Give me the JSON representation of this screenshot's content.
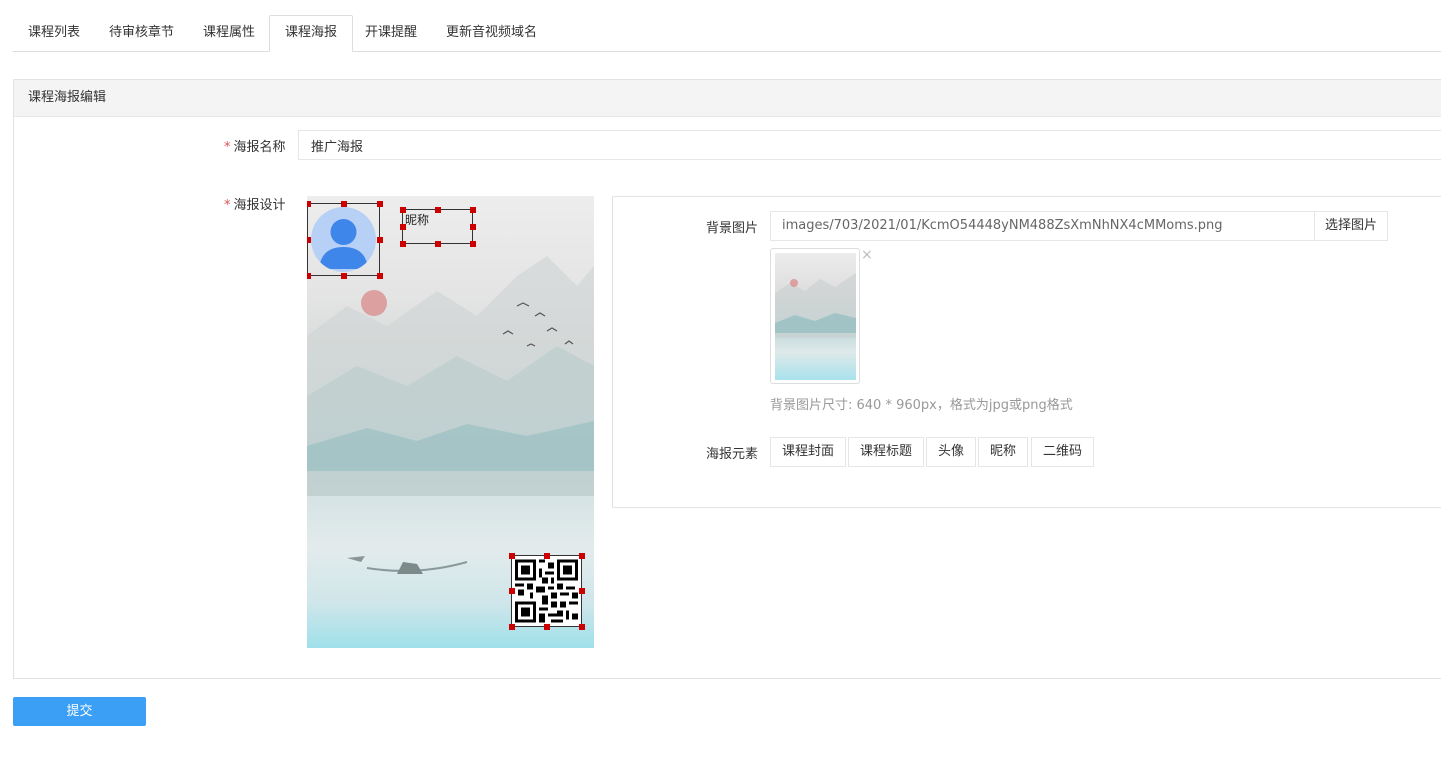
{
  "tabs": [
    {
      "label": "课程列表",
      "active": false
    },
    {
      "label": "待审核章节",
      "active": false
    },
    {
      "label": "课程属性",
      "active": false
    },
    {
      "label": "课程海报",
      "active": true
    },
    {
      "label": "开课提醒",
      "active": false
    },
    {
      "label": "更新音视频域名",
      "active": false
    }
  ],
  "panel": {
    "title": "课程海报编辑",
    "required_mark": "*",
    "poster_name_label": "海报名称",
    "poster_name_value": "推广海报",
    "poster_design_label": "海报设计"
  },
  "poster_canvas": {
    "nickname_text": "昵称"
  },
  "config": {
    "bg_image_label": "背景图片",
    "bg_image_value": "images/703/2021/01/KcmO54448yNM488ZsXmNhNX4cMMoms.png",
    "select_image_button": "选择图片",
    "thumb_close": "×",
    "bg_hint": "背景图片尺寸: 640 * 960px，格式为jpg或png格式",
    "elements_label": "海报元素",
    "elements": [
      "课程封面",
      "课程标题",
      "头像",
      "昵称",
      "二维码"
    ]
  },
  "submit_label": "提交",
  "colors": {
    "primary": "#3a9ff5",
    "handle": "#cc0000",
    "required": "#d9534f"
  }
}
